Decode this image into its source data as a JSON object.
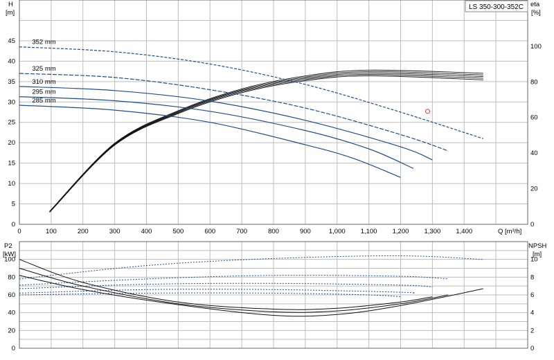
{
  "title": "LS 350-300-352C",
  "colors": {
    "grid": "#bdbdbd",
    "blue": "#1f4e8c",
    "black": "#111111",
    "marker": "#e03030"
  },
  "top_chart": {
    "left_axis": {
      "symbol": "H",
      "unit": "[m]"
    },
    "right_axis": {
      "symbol": "eta",
      "unit": "[%]"
    },
    "x_axis": {
      "label": "Q [m³/h]"
    },
    "x_tick_labels": [
      "0",
      "100",
      "200",
      "300",
      "400",
      "500",
      "600",
      "700",
      "800",
      "900",
      "1,000",
      "1,100",
      "1,200",
      "1,300",
      "1,400"
    ],
    "left_tick_labels": [
      "0",
      "5",
      "10",
      "15",
      "20",
      "25",
      "30",
      "35",
      "40",
      "45"
    ],
    "right_tick_labels": [
      "0",
      "20",
      "40",
      "60",
      "80",
      "100"
    ]
  },
  "bottom_chart": {
    "left_axis": {
      "symbol": "P2",
      "unit": "[kW]"
    },
    "right_axis": {
      "symbol": "NPSH",
      "unit": "[m]"
    },
    "left_tick_labels": [
      "0",
      "20",
      "40",
      "60",
      "80",
      "100"
    ],
    "right_tick_labels": [
      "0",
      "2",
      "4",
      "6",
      "8",
      "10"
    ]
  },
  "chart_data": [
    {
      "type": "line",
      "title": "LS 350-300-352C",
      "xlabel": "Q [m³/h]",
      "ylabel": "H [m]",
      "ylabel_right": "eta [%]",
      "xlim": [
        0,
        1600
      ],
      "ylim": [
        0,
        55
      ],
      "ylim_right": [
        0,
        126
      ],
      "grid": true,
      "head_curves": [
        {
          "name": "352 mm",
          "style": "dashed",
          "x": [
            0,
            300,
            600,
            900,
            1200,
            1460
          ],
          "y": [
            43.5,
            42.3,
            39.3,
            34.3,
            27.5,
            21.0
          ]
        },
        {
          "name": "325 mm",
          "style": "solid_then_dashed",
          "x": [
            0,
            300,
            600,
            900,
            1200,
            1350
          ],
          "y": [
            37.0,
            36.0,
            33.0,
            28.5,
            22.0,
            18.0
          ]
        },
        {
          "name": "310 mm",
          "style": "solid",
          "x": [
            0,
            300,
            600,
            900,
            1200,
            1300
          ],
          "y": [
            33.8,
            32.8,
            30.2,
            25.5,
            19.0,
            15.8
          ]
        },
        {
          "name": "295 mm",
          "style": "solid",
          "x": [
            0,
            300,
            600,
            900,
            1100,
            1240
          ],
          "y": [
            31.3,
            30.3,
            27.7,
            23.0,
            18.5,
            13.7
          ]
        },
        {
          "name": "285 mm",
          "style": "solid",
          "x": [
            0,
            300,
            600,
            900,
            1050,
            1200
          ],
          "y": [
            29.2,
            28.0,
            25.0,
            19.5,
            16.2,
            11.5
          ]
        }
      ],
      "efficiency_curves": [
        {
          "x": [
            95,
            300,
            500,
            700,
            900,
            1100,
            1460
          ],
          "y": [
            7,
            45,
            63,
            75,
            82,
            85,
            83
          ]
        }
      ],
      "marker": {
        "x": 1285,
        "y": 27.7
      }
    },
    {
      "type": "line",
      "xlabel": "Q [m³/h]",
      "ylabel": "P2 [kW]",
      "ylabel_right": "NPSH [m]",
      "xlim": [
        0,
        1600
      ],
      "ylim": [
        0,
        120
      ],
      "ylim_right": [
        0,
        12
      ],
      "grid": true,
      "power_curves": [
        {
          "name": "352 mm",
          "x": [
            0,
            400,
            800,
            1200,
            1460
          ],
          "y": [
            78,
            93,
            101,
            104,
            100
          ]
        },
        {
          "name": "325 mm",
          "x": [
            0,
            400,
            800,
            1200,
            1350
          ],
          "y": [
            71,
            78,
            82,
            81,
            78
          ]
        },
        {
          "name": "310 mm",
          "x": [
            0,
            400,
            800,
            1200,
            1300
          ],
          "y": [
            67,
            72,
            73,
            71,
            69
          ]
        },
        {
          "name": "295 mm",
          "x": [
            0,
            400,
            800,
            1200,
            1240
          ],
          "y": [
            62,
            66,
            66,
            63,
            62
          ]
        },
        {
          "name": "285 mm",
          "x": [
            0,
            400,
            800,
            1100,
            1200
          ],
          "y": [
            60,
            62,
            62,
            60,
            58
          ]
        }
      ],
      "npsh_curves": [
        {
          "x": [
            0,
            200,
            500,
            800,
            1000,
            1200,
            1300
          ],
          "y": [
            10.0,
            7.4,
            5.2,
            4.4,
            4.5,
            5.2,
            5.8
          ]
        },
        {
          "x": [
            0,
            200,
            500,
            800,
            1000,
            1200,
            1350
          ],
          "y": [
            9.0,
            7.0,
            5.0,
            4.1,
            4.2,
            5.0,
            6.0
          ]
        },
        {
          "x": [
            0,
            200,
            500,
            800,
            1000,
            1200,
            1460
          ],
          "y": [
            8.2,
            6.6,
            4.9,
            3.7,
            3.8,
            4.8,
            6.7
          ]
        }
      ]
    }
  ]
}
